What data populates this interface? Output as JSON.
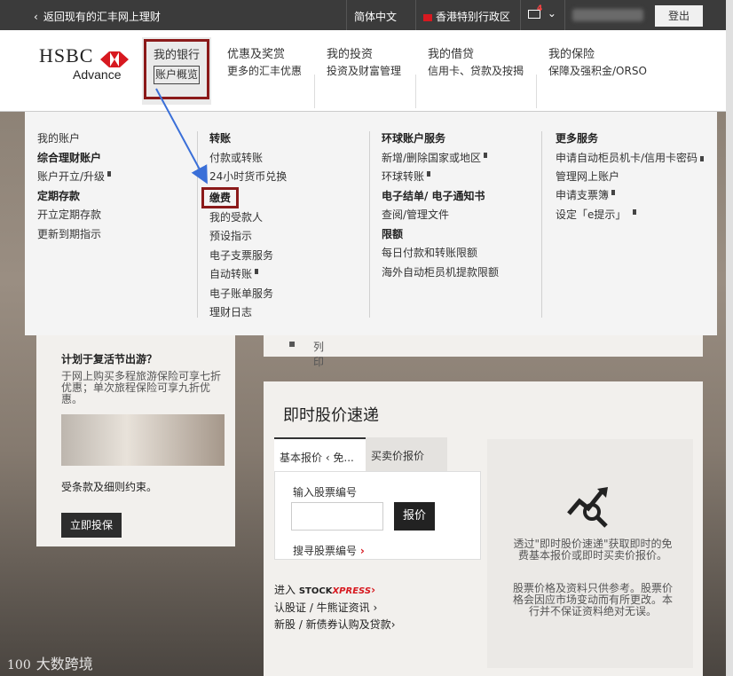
{
  "topbar": {
    "back_label": "返回现有的汇丰网上理财",
    "language": "简体中文",
    "region": "香港特别行政区",
    "mail_count": "4",
    "logout": "登出"
  },
  "header": {
    "logo_text": "HSBC",
    "logo_sub": "Advance",
    "nav": [
      {
        "label": "我的银行",
        "sub": "账户概览"
      },
      {
        "label": "优惠及奖赏",
        "sub": "更多的汇丰优惠"
      },
      {
        "label": "我的投资",
        "sub": "投资及财富管理"
      },
      {
        "label": "我的借贷",
        "sub": "信用卡、贷款及按揭"
      },
      {
        "label": "我的保险",
        "sub": "保障及强积金/ORSO"
      }
    ]
  },
  "mega_menu": {
    "col1": {
      "i0": "我的账户",
      "h1": "综合理财账户",
      "i1": "账户开立/升级",
      "h2": "定期存款",
      "i2": "开立定期存款",
      "i3": "更新到期指示"
    },
    "col2": {
      "h1": "转账",
      "i1": "付款或转账",
      "i2": "24小时货币兑换",
      "i3": "缴费",
      "i4": "我的受款人",
      "i5": "预设指示",
      "i6": "电子支票服务",
      "i7": "自动转账",
      "i8": "电子账单服务",
      "i9": "理财日志"
    },
    "col3": {
      "h1": "环球账户服务",
      "i1": "新增/删除国家或地区",
      "i2": "环球转账",
      "h2": "电子结单/ 电子通知书",
      "i3": "查阅/管理文件",
      "h3": "限额",
      "i4": "每日付款和转账限额",
      "i5": "海外自动柜员机提款限额"
    },
    "col4": {
      "h1": "更多服务",
      "i1": "申请自动柜员机卡/信用卡密码",
      "i2": "管理网上账户",
      "i3": "申请支票簿",
      "i4": "设定「e提示」"
    }
  },
  "promo": {
    "title": "计划于复活节出游？",
    "desc": "于网上购买多程旅游保险可享七折优惠；单次旅程保险可享九折优惠。",
    "terms": "受条款及细则约束。",
    "button": "立即投保"
  },
  "print_label": "列印",
  "quote": {
    "title": "即时股价速递",
    "tab1": "基本报价 ‹ 免...",
    "tab2": "买卖价报价",
    "input_label": "输入股票编号",
    "go": "报价",
    "search": "搜寻股票编号",
    "link1_prefix": "进入 ",
    "link1_stock": "STOCK",
    "link1_xp": "XPRESS",
    "link2": "认股证 / 牛熊证资讯",
    "link3": "新股 / 新债券认购及贷款",
    "info1": "透过\"即时股价速递\"获取即时的免费基本报价或即时买卖价报价。",
    "info2": "股票价格及资料只供参考。股票价格会因应市场变动而有所更改。本行并不保证资料绝对无误。"
  },
  "watermark": {
    "logo": "100",
    "text": "大数跨境"
  },
  "colors": {
    "topbar": "#3b3b3b",
    "brand_red": "#d71920",
    "highlight_box": "#8b1a1a",
    "arrow": "#3a6fd8"
  }
}
